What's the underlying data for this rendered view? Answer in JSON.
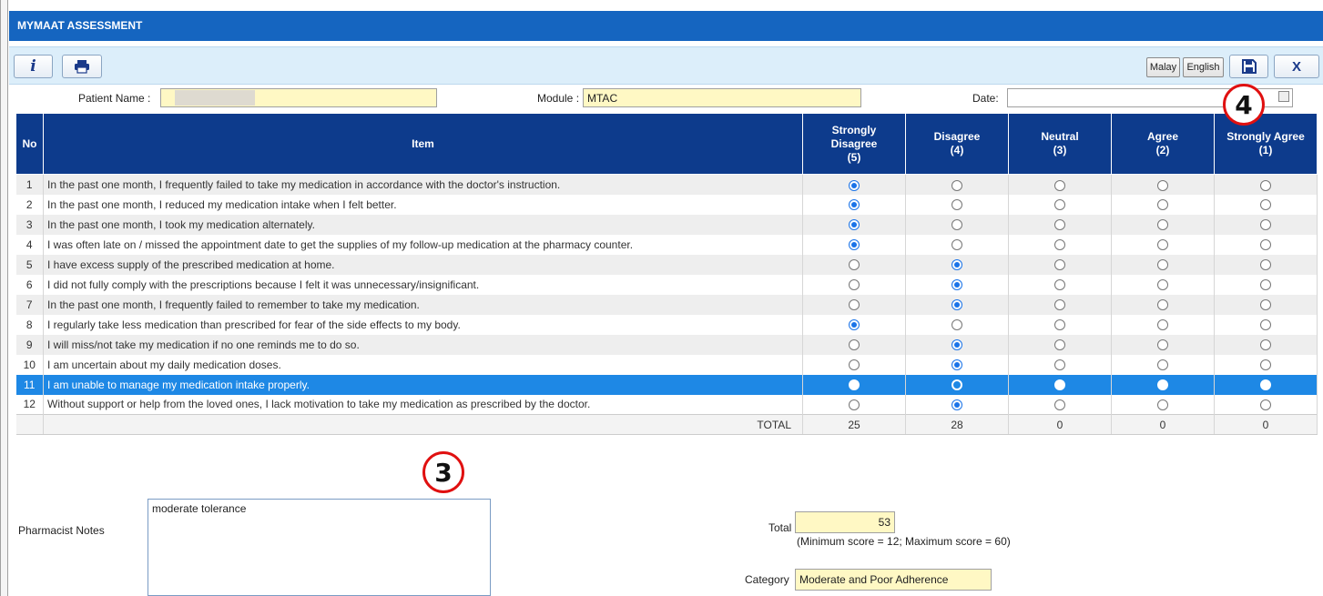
{
  "window": {
    "title": "MYMAAT ASSESSMENT"
  },
  "toolbar": {
    "info_icon": "info-icon",
    "print_icon": "print-icon",
    "malay_label": "Malay",
    "english_label": "English",
    "save_icon": "save-icon",
    "close_label": "X"
  },
  "header": {
    "patient_label": "Patient Name :",
    "patient_value": "",
    "module_label": "Module :",
    "module_value": "MTAC",
    "date_label": "Date:",
    "date_value": ""
  },
  "table": {
    "columns": {
      "no": "No",
      "item": "Item",
      "sd": [
        "Strongly",
        "Disagree",
        "(5)"
      ],
      "d": [
        "Disagree",
        "(4)"
      ],
      "n": [
        "Neutral",
        "(3)"
      ],
      "a": [
        "Agree",
        "(2)"
      ],
      "sa": [
        "Strongly Agree",
        "(1)"
      ]
    },
    "rows": [
      {
        "no": "1",
        "item": "In the past one month, I frequently failed to take my medication in accordance with the doctor's instruction.",
        "choice": 0
      },
      {
        "no": "2",
        "item": "In the past one month, I reduced my medication intake when I felt better.",
        "choice": 0
      },
      {
        "no": "3",
        "item": "In the past one month, I took my medication alternately.",
        "choice": 0
      },
      {
        "no": "4",
        "item": "I was often late on / missed the appointment date to get the supplies of my follow-up medication at the pharmacy counter.",
        "choice": 0
      },
      {
        "no": "5",
        "item": "I have excess supply of the prescribed medication at home.",
        "choice": 1
      },
      {
        "no": "6",
        "item": "I did not fully comply with the prescriptions because I felt it was unnecessary/insignificant.",
        "choice": 1
      },
      {
        "no": "7",
        "item": "In the past one month, I frequently failed to remember to take my medication.",
        "choice": 1
      },
      {
        "no": "8",
        "item": "I regularly take less medication than prescribed for fear of the side effects to my body.",
        "choice": 0
      },
      {
        "no": "9",
        "item": "I will miss/not take my medication if no one reminds me to do so.",
        "choice": 1
      },
      {
        "no": "10",
        "item": "I am uncertain about my daily medication doses.",
        "choice": 1
      },
      {
        "no": "11",
        "item": "I am unable to manage my medication intake properly.",
        "choice": 1
      },
      {
        "no": "12",
        "item": "Without support or help from the loved ones, I lack motivation to take my medication as prescribed by the doctor.",
        "choice": 1
      }
    ],
    "total_label": "TOTAL",
    "totals": [
      "25",
      "28",
      "0",
      "0",
      "0"
    ]
  },
  "markers": {
    "m3": "3",
    "m4": "4"
  },
  "notes": {
    "label": "Pharmacist Notes",
    "value": "moderate tolerance"
  },
  "summary": {
    "total_label": "Total",
    "total_value": "53",
    "score_hint": "(Minimum score = 12; Maximum score = 60)",
    "category_label": "Category",
    "category_value": "Moderate and Poor Adherence"
  }
}
